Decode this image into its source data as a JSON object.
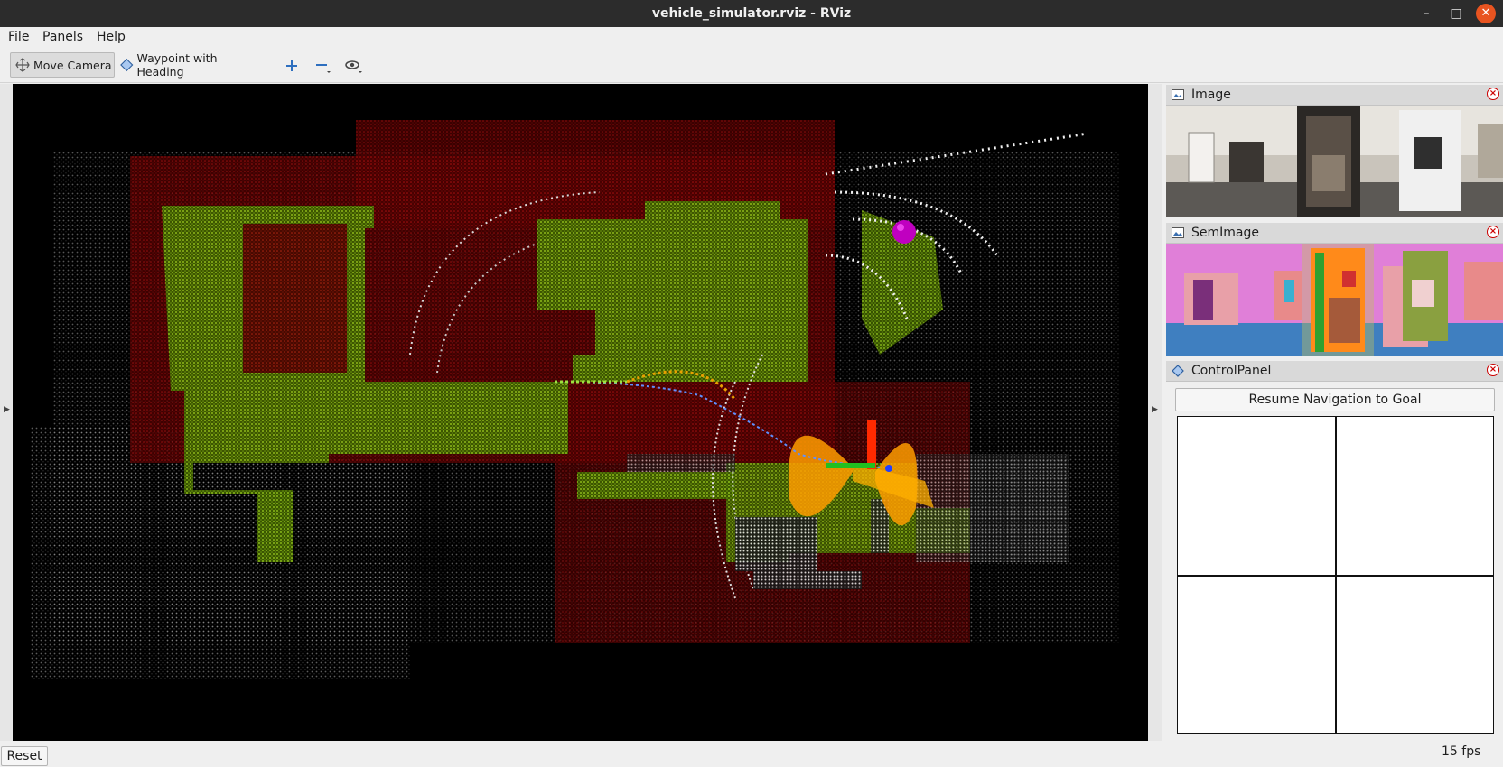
{
  "window": {
    "title": "vehicle_simulator.rviz - RViz"
  },
  "menu": {
    "file": "File",
    "panels": "Panels",
    "help": "Help"
  },
  "toolbar": {
    "move_camera": "Move Camera",
    "waypoint": "Waypoint with Heading",
    "icons": [
      "move-camera-icon",
      "waypoint-icon",
      "add-tool-icon",
      "remove-tool-icon",
      "view-icon"
    ]
  },
  "panels": {
    "image": {
      "title": "Image"
    },
    "sem_image": {
      "title": "SemImage"
    },
    "control": {
      "title": "ControlPanel",
      "resume_label": "Resume Navigation to Goal"
    }
  },
  "status": {
    "reset": "Reset",
    "fps": "15 fps"
  },
  "colors": {
    "titlebar": "#2c2c2c",
    "close": "#e95420",
    "viewport": "#000000",
    "accent_red": "#8b0000",
    "accent_green": "#7fb800",
    "accent_orange": "#ff9900",
    "goal_marker": "#c000c0"
  }
}
